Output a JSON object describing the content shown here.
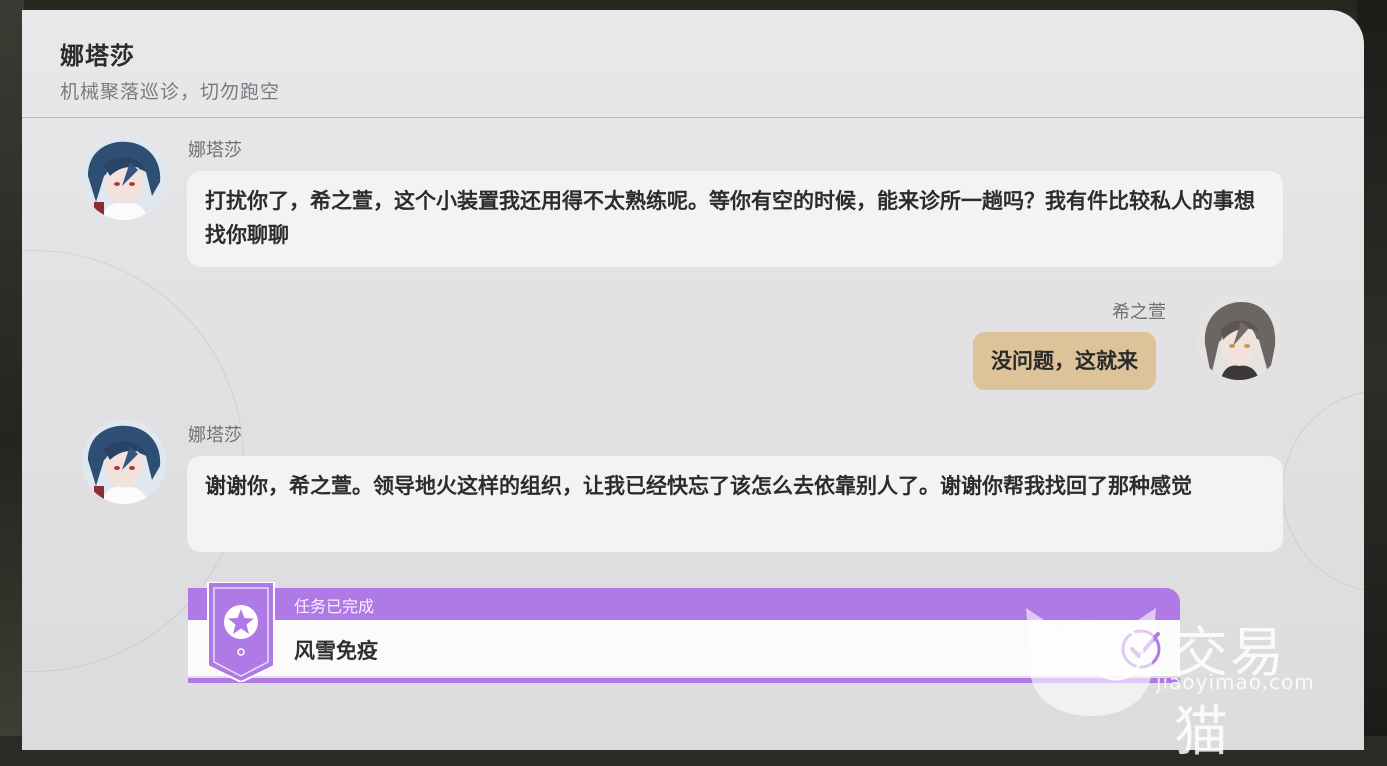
{
  "header": {
    "title": "娜塔莎",
    "subtitle": "机械聚落巡诊，切勿跑空"
  },
  "messages": [
    {
      "sender": "娜塔莎",
      "text": "打扰你了，希之萱，这个小装置我还用得不太熟练呢。等你有空的时候，能来诊所一趟吗？我有件比较私人的事想找你聊聊"
    },
    {
      "sender": "希之萱",
      "text": "没问题，这就来"
    },
    {
      "sender": "娜塔莎",
      "text": "谢谢你，希之萱。领导地火这样的组织，让我已经快忘了该怎么去依靠别人了。谢谢你帮我找回了那种感觉"
    }
  ],
  "task": {
    "status": "任务已完成",
    "name": "风雪免疫",
    "icon": "star-badge-icon",
    "check_icon": "check-circle-icon"
  },
  "watermark": {
    "brand": "交易猫",
    "url": "jiaoyimao.com"
  },
  "colors": {
    "panel_bg": "#e5e4e6",
    "bubble_other": "#f3f2f4",
    "bubble_self": "#dcc39a",
    "task_accent": "#b07ae6"
  }
}
